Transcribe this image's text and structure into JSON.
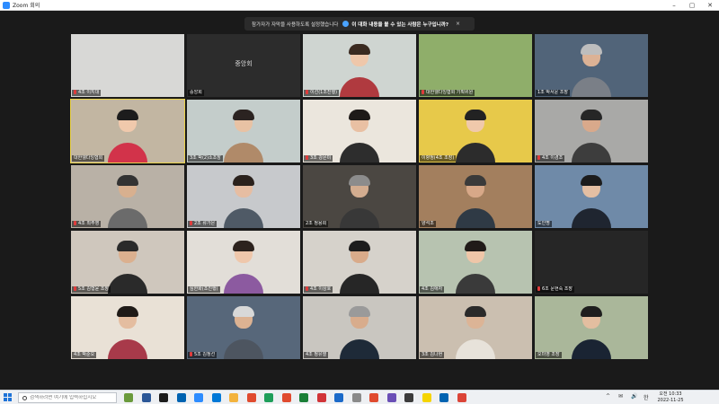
{
  "window": {
    "title": "Zoom 회의"
  },
  "notice": {
    "text": "참가자가 자막을 사용하도록 설정했습니다",
    "question": "이 대화 내용을 볼 수 있는 사람은 누구입니까?",
    "close": "×"
  },
  "grid": {
    "rows": [
      [
        {
          "name": "4조 이지대",
          "muted": true,
          "bg": "#d8d8d6",
          "head": "#f1d9c8",
          "hair": "#ffffff",
          "torso": "#cfcfcf",
          "face": false
        },
        {
          "name": "중앙회",
          "muted": false,
          "bg": "#2c2c2c",
          "center": "중앙회",
          "face": false
        },
        {
          "name": "이선(1조진행)",
          "muted": true,
          "bg": "#cfd5d1",
          "head": "#efc7aa",
          "hair": "#3a2a20",
          "torso": "#b03a3f",
          "face": true
        },
        {
          "name": "대한웰다잉협회 기획위원",
          "muted": true,
          "bg": "#8fae6a",
          "face": false
        },
        {
          "name": "1조 박서운 조장",
          "muted": false,
          "bg": "#516479",
          "head": "#dcb295",
          "hair": "#bdbdbd",
          "torso": "#7a7f87",
          "face": true
        }
      ],
      [
        {
          "name": "대한웰다잉협회",
          "muted": false,
          "bg": "#c2b6a2",
          "head": "#f0c9ac",
          "hair": "#1c1c1c",
          "torso": "#d2334a",
          "face": true,
          "active": true
        },
        {
          "name": "3조 박(2)소조장",
          "muted": false,
          "bg": "#c4cdcb",
          "head": "#e8c2a4",
          "hair": "#2b2321",
          "torso": "#b08a69",
          "face": true
        },
        {
          "name": "3조 강은미",
          "muted": true,
          "bg": "#ebe6dd",
          "head": "#e9c0a3",
          "hair": "#1e1a18",
          "torso": "#2d2d2d",
          "face": true
        },
        {
          "name": "이향정(4조 조장)",
          "muted": false,
          "bg": "#e7c94a",
          "head": "#f0c9ab",
          "hair": "#222222",
          "torso": "#2c2c2c",
          "face": true
        },
        {
          "name": "4조 이경조",
          "muted": true,
          "bg": "#a9a9a7",
          "head": "#d9a98b",
          "hair": "#262626",
          "torso": "#3d3d3d",
          "face": true
        }
      ],
      [
        {
          "name": "4조 최주영",
          "muted": true,
          "bg": "#b9b1a6",
          "head": "#d8b08f",
          "hair": "#333333",
          "torso": "#6b6b6b",
          "face": true
        },
        {
          "name": "2조 류가은",
          "muted": true,
          "bg": "#c7c9cc",
          "head": "#e6bda2",
          "hair": "#2a211c",
          "torso": "#4f5a66",
          "face": true
        },
        {
          "name": "2조 정용희",
          "muted": false,
          "bg": "#4b4742",
          "head": "#d3ad90",
          "hair": "#8c8c8c",
          "torso": "#383838",
          "face": true
        },
        {
          "name": "양석조",
          "muted": false,
          "bg": "#a37f5e",
          "head": "#d7a888",
          "hair": "#3a3a3a",
          "torso": "#2f3a45",
          "face": true
        },
        {
          "name": "도인명",
          "muted": false,
          "bg": "#6f8aa8",
          "head": "#e4bfa3",
          "hair": "#1c1c1c",
          "torso": "#1f2530",
          "face": true
        }
      ],
      [
        {
          "name": "5조 김형윤 조장",
          "muted": true,
          "bg": "#cfc7bd",
          "head": "#dbb08f",
          "hair": "#2a2a2a",
          "torso": "#2a2a2a",
          "face": true
        },
        {
          "name": "심한화(조진행)",
          "muted": false,
          "bg": "#e2ded8",
          "head": "#efc7ab",
          "hair": "#2c221d",
          "torso": "#8c5aa0",
          "face": true
        },
        {
          "name": "4조 이상호",
          "muted": true,
          "bg": "#d6d2cb",
          "head": "#d9ab8a",
          "hair": "#1d1d1d",
          "torso": "#262626",
          "face": true
        },
        {
          "name": "4조 김애자",
          "muted": false,
          "bg": "#b7c3b0",
          "head": "#efc6a8",
          "hair": "#201a18",
          "torso": "#3a3a3a",
          "face": true
        },
        {
          "name": "6조 문현숙 조장",
          "muted": true,
          "bg": "#262626",
          "face": false
        }
      ],
      [
        {
          "name": "4조 박순오",
          "muted": false,
          "bg": "#e9e1d6",
          "head": "#e4bda0",
          "hair": "#1f1a17",
          "torso": "#a83a4a",
          "face": true
        },
        {
          "name": "5조 김정선",
          "muted": true,
          "bg": "#57677a",
          "head": "#dcb292",
          "hair": "#d8d8d8",
          "torso": "#4d5560",
          "face": true
        },
        {
          "name": "4조 정유열",
          "muted": false,
          "bg": "#c9c6c0",
          "head": "#d8ac8c",
          "hair": "#9a9a9a",
          "torso": "#1e2a38",
          "face": true
        },
        {
          "name": "3조 김나현",
          "muted": false,
          "bg": "#cbbfb0",
          "head": "#dcb496",
          "hair": "#2a2a2a",
          "torso": "#e7e2da",
          "face": true
        },
        {
          "name": "오미영 조장",
          "muted": false,
          "bg": "#aab79a",
          "head": "#e3bea0",
          "hair": "#1e1e1e",
          "torso": "#1a2433",
          "face": true
        }
      ]
    ]
  },
  "taskbar": {
    "search_placeholder": "검색하려면 여기에 입력하십시오",
    "apps": [
      "#6a9a3c",
      "#2b5797",
      "#1c1c1c",
      "#0063b1",
      "#2d8cff",
      "#0078d7",
      "#f3b33d",
      "#e04b2f",
      "#1e9e5a",
      "#e04b2f",
      "#1a7f37",
      "#d13438",
      "#1b6ac9",
      "#8a8a8a",
      "#e04b2f",
      "#6a4fb6",
      "#3c3c3c",
      "#f5d400",
      "#0063b1",
      "#db4437"
    ],
    "tray_icons": [
      "^",
      "✉",
      "🔊",
      "한"
    ],
    "time": "오전 10:33",
    "date": "2022-11-25"
  }
}
